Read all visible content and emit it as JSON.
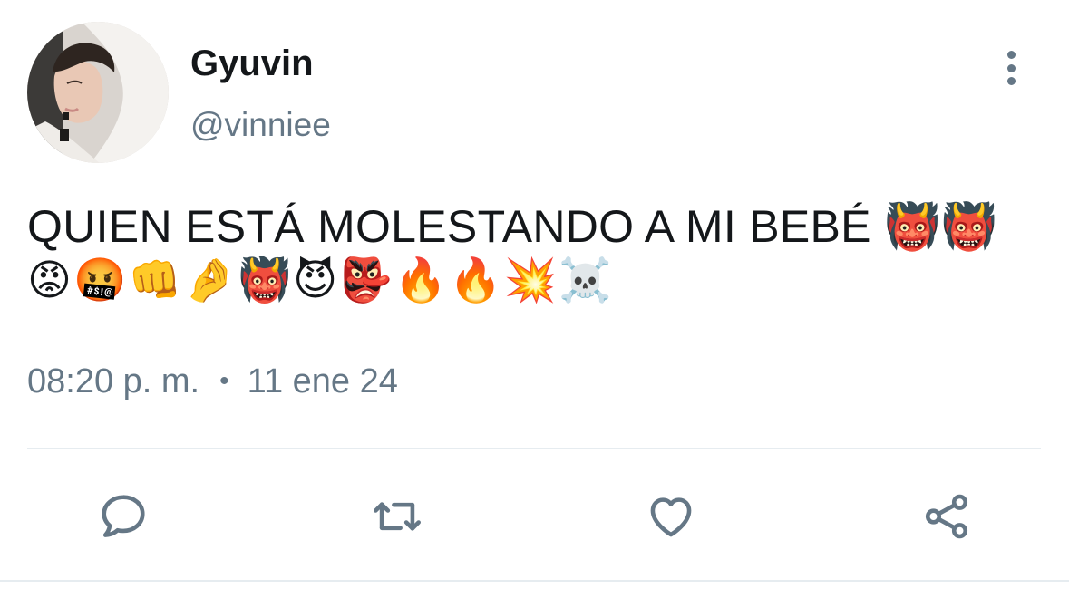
{
  "author": {
    "display_name": "Gyuvin",
    "handle": "@vinniee",
    "avatar": "profile-photo"
  },
  "tweet": {
    "text_line1": "QUIEN ESTÁ MOLESTANDO A MI BEBÉ 👹👹",
    "text_line2": "😡🤬👊🤌👹😈👺🔥🔥💥☠️"
  },
  "meta": {
    "time": "08:20 p. m.",
    "separator": "•",
    "date": "11 ene 24"
  },
  "actions": [
    {
      "icon": "reply-icon"
    },
    {
      "icon": "retweet-icon"
    },
    {
      "icon": "like-icon"
    },
    {
      "icon": "share-icon"
    }
  ],
  "menu": {
    "icon": "more-options-icon"
  },
  "colors": {
    "text": "#14171a",
    "secondary": "#657786",
    "divider": "#e6ecf0"
  }
}
